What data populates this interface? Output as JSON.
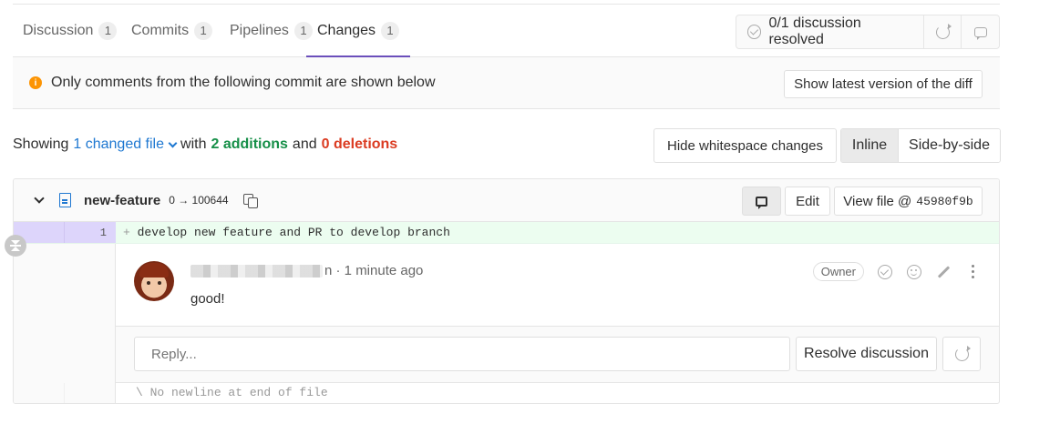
{
  "tabs": [
    {
      "label": "Discussion",
      "count": "1"
    },
    {
      "label": "Commits",
      "count": "1"
    },
    {
      "label": "Pipelines",
      "count": "1"
    },
    {
      "label": "Changes",
      "count": "1",
      "active": true
    }
  ],
  "resolve_status": "0/1 discussion resolved",
  "banner": {
    "text": "Only comments from the following commit are shown below",
    "button": "Show latest version of the diff"
  },
  "summary": {
    "showing": "Showing",
    "changed_files": "1 changed file",
    "with": "with",
    "additions": "2 additions",
    "and": "and",
    "deletions": "0 deletions"
  },
  "view_controls": {
    "whitespace": "Hide whitespace changes",
    "inline": "Inline",
    "side_by_side": "Side-by-side"
  },
  "file": {
    "name": "new-feature",
    "mode": "0 → 100644",
    "edit": "Edit",
    "view_file": "View file @",
    "commit_sha": "45980f9b"
  },
  "diff": {
    "line_number": "1",
    "prefix": "+",
    "code": "develop new feature and PR to develop branch",
    "no_newline": "\\ No newline at end of file"
  },
  "note": {
    "author_suffix": "n",
    "time": "· 1 minute ago",
    "role": "Owner",
    "text": "good!"
  },
  "reply": {
    "placeholder": "Reply...",
    "resolve_button": "Resolve discussion"
  },
  "colors": {
    "active_tab": "#6b4fbb",
    "link": "#1f78d1",
    "additions": "#168f48",
    "deletions": "#db3b21",
    "info": "#fc9403",
    "added_line_bg": "#ecfdf0"
  }
}
